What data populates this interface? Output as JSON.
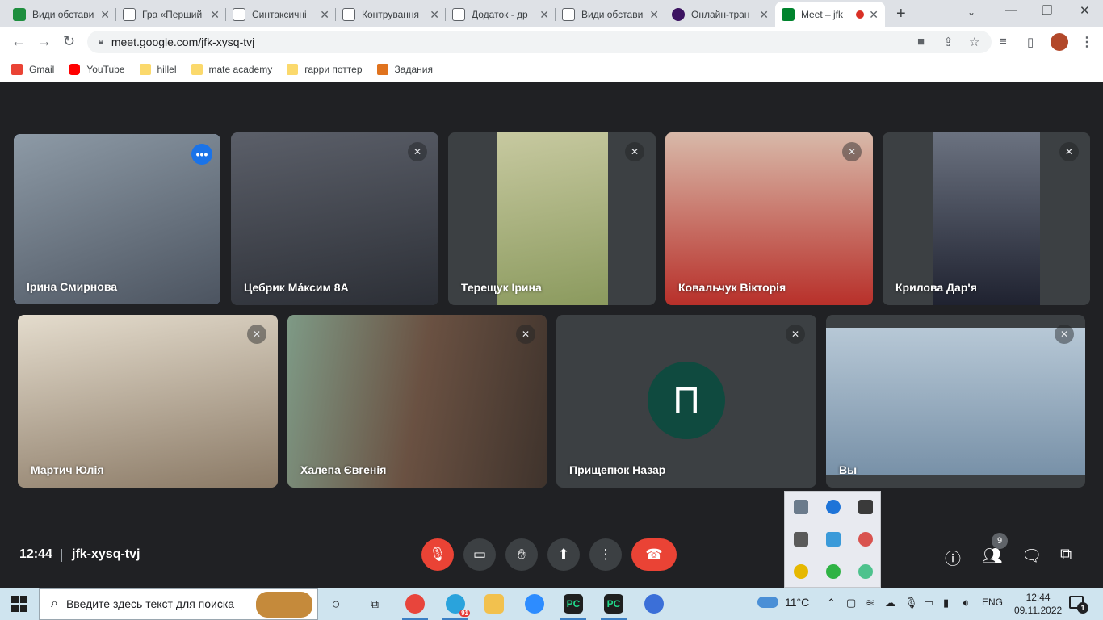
{
  "browser": {
    "tabs": [
      {
        "title": "Види обстави",
        "icon": "google-classroom-icon",
        "color": "#1e8e3e"
      },
      {
        "title": "Гра «Перший",
        "icon": "classroom-doc-icon",
        "color": "#5f6368"
      },
      {
        "title": "Синтаксичні",
        "icon": "classroom-doc-icon",
        "color": "#5f6368"
      },
      {
        "title": "Контрування",
        "icon": "classroom-doc-icon",
        "color": "#5f6368"
      },
      {
        "title": "Додаток - др",
        "icon": "classroom-doc-icon",
        "color": "#5f6368"
      },
      {
        "title": "Види обстави",
        "icon": "classroom-doc-icon",
        "color": "#5f6368"
      },
      {
        "title": "Онлайн-тран",
        "icon": "circle-icon",
        "color": "#3c1361"
      },
      {
        "title": "Meet – jfk",
        "icon": "google-meet-icon",
        "color": "#00832d",
        "active": true
      }
    ],
    "url": "meet.google.com/jfk-xysq-tvj",
    "bookmarks": [
      {
        "label": "Gmail",
        "color": "#ea4335"
      },
      {
        "label": "YouTube",
        "color": "#ff0000"
      },
      {
        "label": "hillel",
        "color": "#fbd96c"
      },
      {
        "label": "mate academy",
        "color": "#fbd96c"
      },
      {
        "label": "гарри поттер",
        "color": "#fbd96c"
      },
      {
        "label": "Задания",
        "color": "#e0731e"
      }
    ]
  },
  "meet": {
    "participants_row1": [
      {
        "name": "Ірина Смирнова",
        "speaking": true,
        "video_color": "#7a8793"
      },
      {
        "name": "Цебрик Ма́ксим 8А",
        "muted": true,
        "video_color": "#4a4d55"
      },
      {
        "name": "Терещук Ірина",
        "muted": true,
        "video_color": "#9aa77a"
      },
      {
        "name": "Ковальчук Вікторія",
        "muted": true,
        "video_color": "#c2453f"
      },
      {
        "name": "Крилова Дар'я",
        "muted": true,
        "video_color": "#2f3340"
      }
    ],
    "participants_row2": [
      {
        "name": "Мартич Юлія",
        "muted": true,
        "video_color": "#c9b8a2"
      },
      {
        "name": "Халепа Євгенія",
        "muted": true,
        "video_color": "#5e5148"
      },
      {
        "name": "Прищепюк Назар",
        "muted": true,
        "avatar_letter": "П"
      },
      {
        "name": "Вы",
        "muted": true,
        "video_color": "#8fa6bd"
      }
    ],
    "time": "12:44",
    "meeting_code": "jfk-xysq-tvj",
    "participant_count": "9"
  },
  "taskbar": {
    "search_placeholder": "Введите здесь текст для поиска",
    "telegram_badge": "91",
    "temperature": "11°C",
    "language": "ENG",
    "time": "12:44",
    "date": "09.11.2022",
    "notification_count": "1"
  }
}
